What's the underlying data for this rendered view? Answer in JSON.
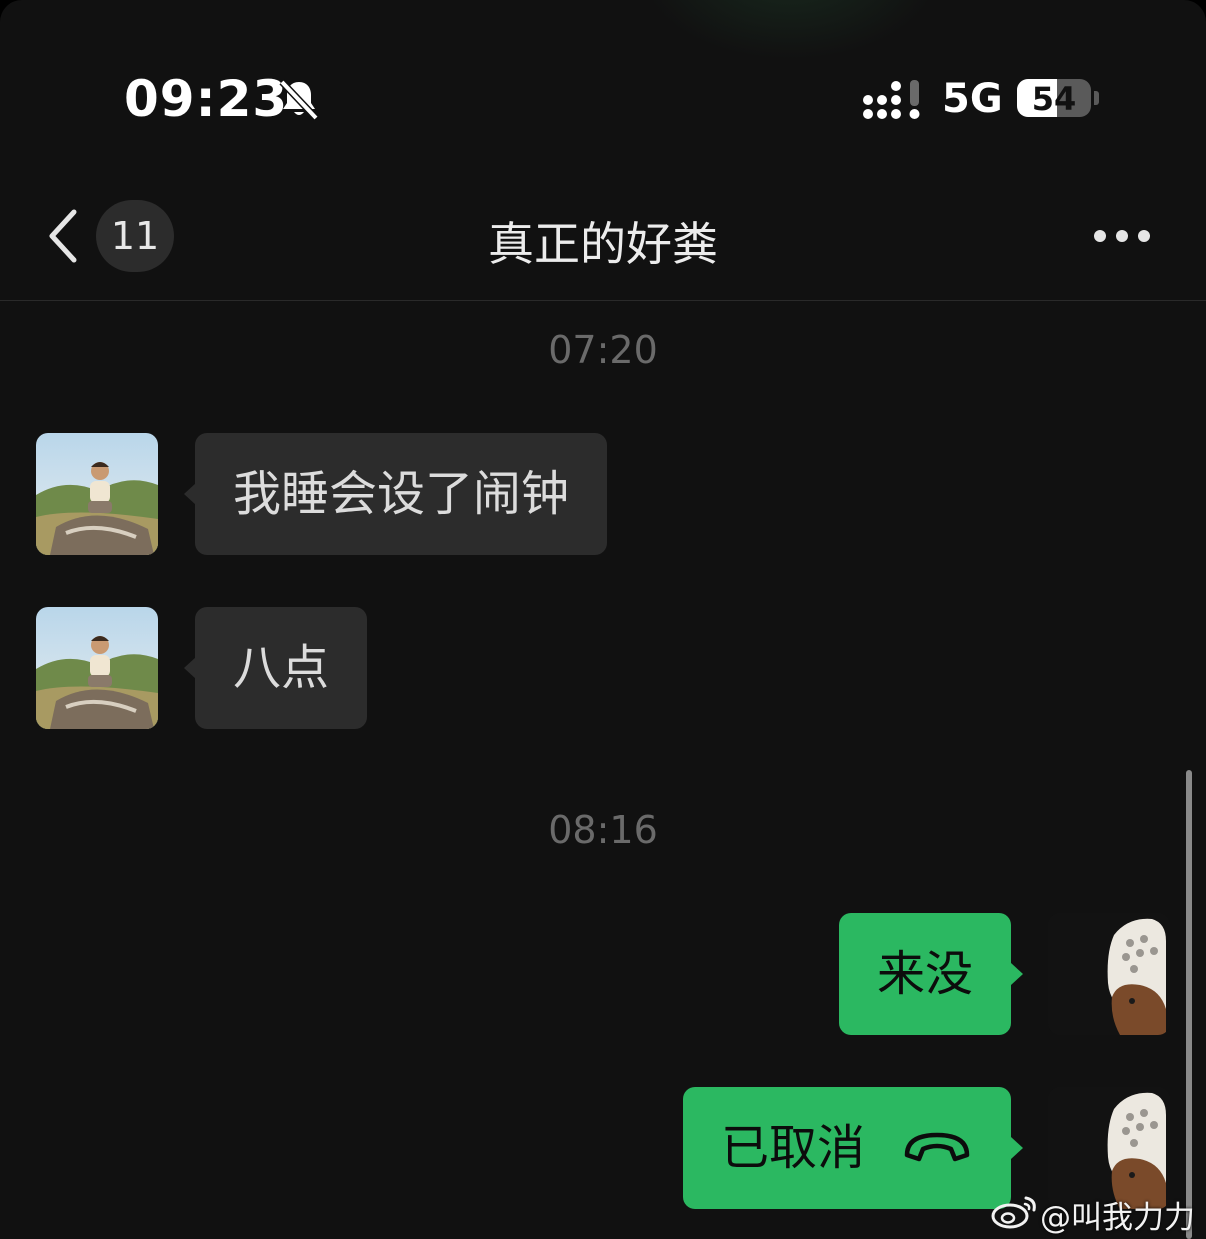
{
  "status_bar": {
    "time": "09:23",
    "network": "5G",
    "battery": "54",
    "battery_level_percent": 54,
    "silent_icon": "bell-slash-icon",
    "signal_icon": "cellular-signal-icon"
  },
  "nav": {
    "back_icon": "chevron-left-icon",
    "unread_count": "11",
    "title": "真正的好粪",
    "more_icon": "more-dots-icon"
  },
  "messages": [
    {
      "type": "timestamp",
      "text": "07:20"
    },
    {
      "type": "incoming",
      "text": "我睡会设了闹钟"
    },
    {
      "type": "incoming",
      "text": "八点"
    },
    {
      "type": "timestamp",
      "text": "08:16"
    },
    {
      "type": "outgoing",
      "text": "来没"
    },
    {
      "type": "outgoing_call",
      "text": "已取消",
      "icon": "hang-up-phone-icon"
    }
  ],
  "watermark": {
    "icon": "weibo-logo-icon",
    "text": "@叫我力力"
  },
  "colors": {
    "background": "#111111",
    "incoming_bubble": "#2c2c2c",
    "outgoing_bubble": "#2bb861",
    "timestamp": "#6a6a6a"
  }
}
